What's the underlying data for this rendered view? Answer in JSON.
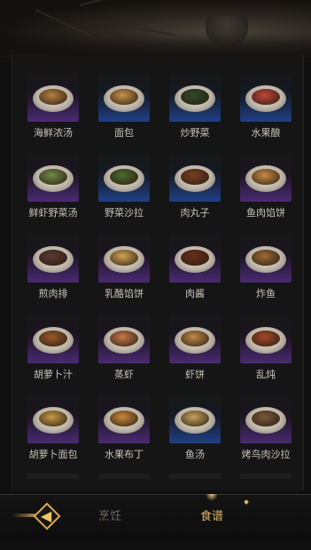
{
  "recipes": [
    {
      "name": "海鲜浓汤",
      "rarity": "purple",
      "food_color": "#b5813e"
    },
    {
      "name": "面包",
      "rarity": "blue",
      "food_color": "#c7934a"
    },
    {
      "name": "炒野菜",
      "rarity": "blue",
      "food_color": "#2e4a2a"
    },
    {
      "name": "水果酿",
      "rarity": "blue",
      "food_color": "#c1453b"
    },
    {
      "name": "鲜虾野菜汤",
      "rarity": "purple",
      "food_color": "#6f8a47"
    },
    {
      "name": "野菜沙拉",
      "rarity": "blue",
      "food_color": "#4d6a2f"
    },
    {
      "name": "肉丸子",
      "rarity": "blue",
      "food_color": "#7a3f23"
    },
    {
      "name": "鱼肉馅饼",
      "rarity": "purple",
      "food_color": "#c98a43"
    },
    {
      "name": "煎肉排",
      "rarity": "purple",
      "food_color": "#5a3a33"
    },
    {
      "name": "乳酪馅饼",
      "rarity": "purple",
      "food_color": "#d2a455"
    },
    {
      "name": "肉酱",
      "rarity": "purple",
      "food_color": "#6b2e1a"
    },
    {
      "name": "炸鱼",
      "rarity": "purple",
      "food_color": "#9c6a33"
    },
    {
      "name": "胡萝卜汁",
      "rarity": "purple",
      "food_color": "#9a5a2a"
    },
    {
      "name": "蒸虾",
      "rarity": "purple",
      "food_color": "#c6794a"
    },
    {
      "name": "虾饼",
      "rarity": "purple",
      "food_color": "#c18a4a"
    },
    {
      "name": "乱炖",
      "rarity": "purple",
      "food_color": "#a4482a"
    },
    {
      "name": "胡萝卜面包",
      "rarity": "purple",
      "food_color": "#c79a45"
    },
    {
      "name": "水果布丁",
      "rarity": "purple",
      "food_color": "#c88a3c"
    },
    {
      "name": "鱼汤",
      "rarity": "blue",
      "food_color": "#c6a35e"
    },
    {
      "name": "烤鸟肉沙拉",
      "rarity": "purple",
      "food_color": "#7a5a3a"
    }
  ],
  "tabs": {
    "cook": "烹饪",
    "recipe": "食谱"
  },
  "active_tab": "recipe",
  "colors": {
    "rarity_purple": "#4a2a73",
    "rarity_blue": "#1f3f85",
    "tab_active": "#e0b463",
    "tab_inactive": "#6f6a62",
    "accent_gold": "#d8aa58"
  },
  "icons": {
    "back": "back-arrow-icon"
  }
}
